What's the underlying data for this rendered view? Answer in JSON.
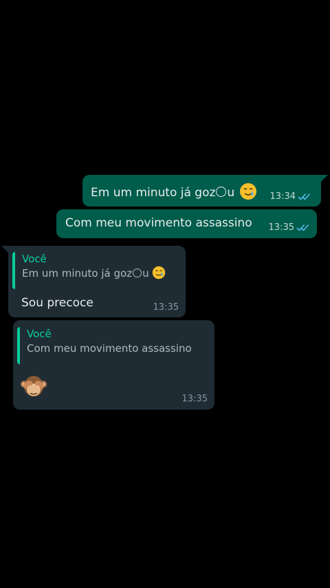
{
  "messages": {
    "m1": {
      "text_before": "Em um minuto já goz",
      "text_after": "u",
      "time": "13:34",
      "emoji": "crying-smile-emoji",
      "status": "read"
    },
    "m2": {
      "text": "Com meu movimento assassino",
      "time": "13:35",
      "status": "read"
    },
    "m3": {
      "quote_author": "Você",
      "quote_text_before": "Em um minuto já goz",
      "quote_text_after": "u",
      "text": "Sou precoce",
      "time": "13:35"
    },
    "m4": {
      "quote_author": "Você",
      "quote_text": "Com meu movimento assassino",
      "emoji": "see-no-evil-monkey-emoji",
      "time": "13:35"
    }
  },
  "colors": {
    "background": "#000000",
    "outgoing_bubble": "#005c4b",
    "incoming_bubble": "#1f2c34",
    "accent": "#06cf9c",
    "read_ticks": "#53bdeb"
  }
}
